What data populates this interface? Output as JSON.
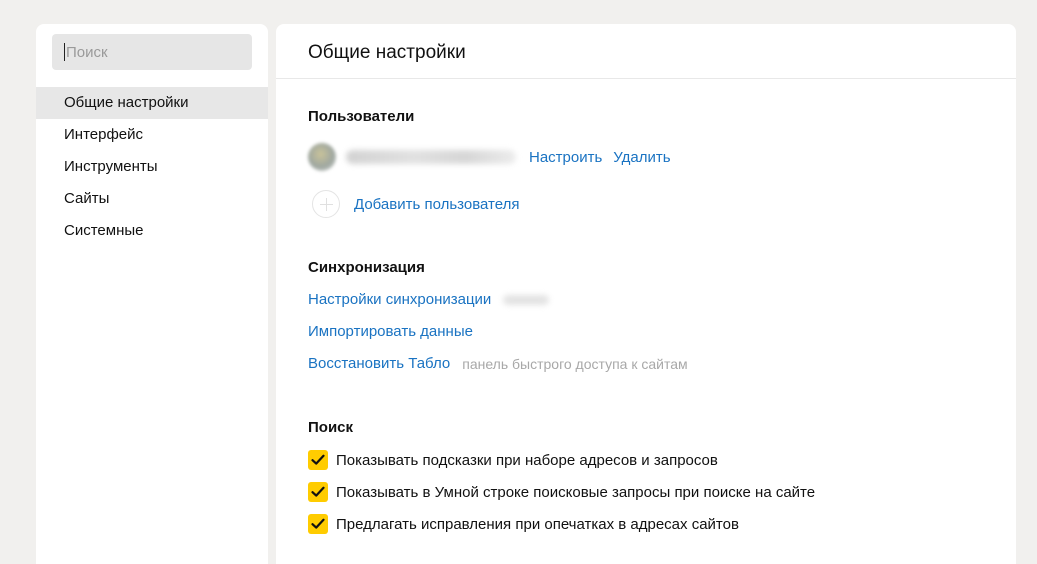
{
  "search": {
    "placeholder": "Поиск"
  },
  "sidebar": {
    "items": [
      {
        "label": "Общие настройки",
        "active": true
      },
      {
        "label": "Интерфейс"
      },
      {
        "label": "Инструменты"
      },
      {
        "label": "Сайты"
      },
      {
        "label": "Системные"
      }
    ]
  },
  "main": {
    "title": "Общие настройки",
    "users": {
      "title": "Пользователи",
      "configure_label": "Настроить",
      "delete_label": "Удалить",
      "add_label": "Добавить пользователя"
    },
    "sync": {
      "title": "Синхронизация",
      "settings_label": "Настройки синхронизации",
      "import_label": "Импортировать данные",
      "restore_label": "Восстановить Табло",
      "restore_hint": "панель быстрого доступа к сайтам"
    },
    "search": {
      "title": "Поиск",
      "options": [
        {
          "label": "Показывать подсказки при наборе адресов и запросов",
          "checked": true
        },
        {
          "label": "Показывать в Умной строке поисковые запросы при поиске на сайте",
          "checked": true
        },
        {
          "label": "Предлагать исправления при опечатках в адресах сайтов",
          "checked": true
        }
      ]
    }
  },
  "colors": {
    "link": "#1a73c2",
    "checkbox": "#ffcc00",
    "background": "#f1f0ee"
  }
}
